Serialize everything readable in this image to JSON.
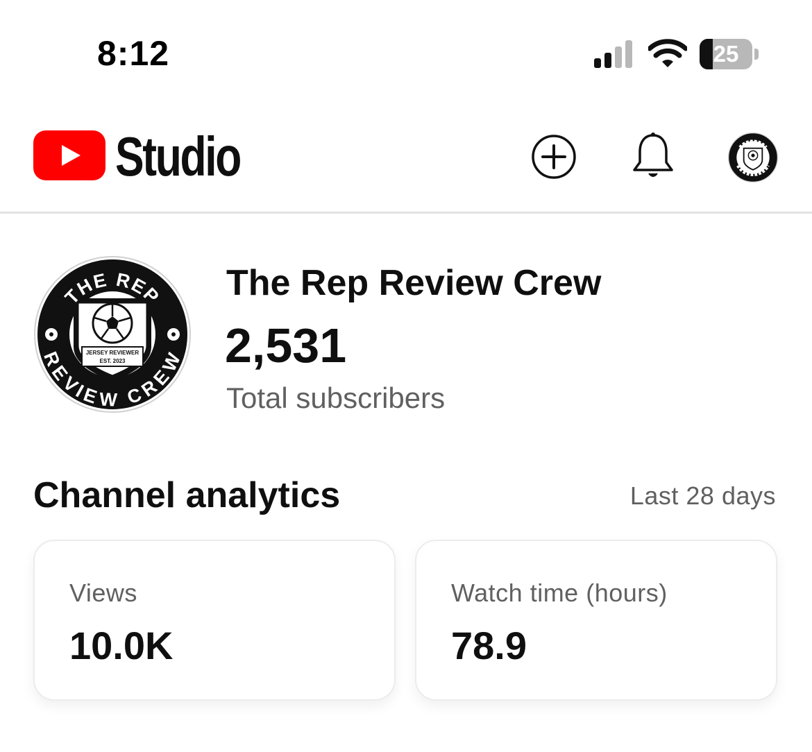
{
  "status_bar": {
    "time": "8:12",
    "battery": "25",
    "battery_level": 0.25,
    "icons": [
      "cellular-signal-icon",
      "wifi-icon",
      "battery-icon"
    ]
  },
  "header": {
    "logo_icon": "youtube-play-icon",
    "brand_color": "#ff0000",
    "app_name": "Studio",
    "actions": [
      "create-icon",
      "notifications-bell-icon",
      "account-avatar"
    ]
  },
  "channel": {
    "name": "The Rep Review Crew",
    "subscriber_count": "2,531",
    "subscriber_label": "Total subscribers",
    "logo": {
      "top_text": "THE REP",
      "bottom_text": "REVIEW CREW",
      "badge_line1": "JERSEY REVIEWER",
      "badge_line2": "EST. 2023"
    }
  },
  "analytics": {
    "title": "Channel analytics",
    "range": "Last 28 days",
    "cards": [
      {
        "label": "Views",
        "value": "10.0K"
      },
      {
        "label": "Watch time (hours)",
        "value": "78.9"
      }
    ]
  }
}
